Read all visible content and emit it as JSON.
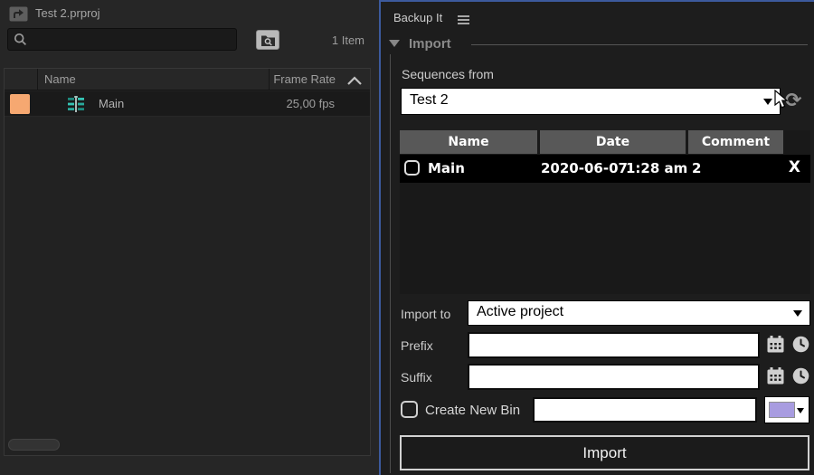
{
  "colors": {
    "accent_border": "#3c5a9d",
    "swatch_orange": "#f6a871",
    "bin_purple": "#a89ce0",
    "sequence_teal": "#2fbca9"
  },
  "left_panel": {
    "title": "Test 2.prproj",
    "search_placeholder": "",
    "item_count": "1 Item",
    "columns": {
      "name": "Name",
      "frame_rate": "Frame Rate"
    },
    "rows": [
      {
        "name": "Main",
        "frame_rate": "25,00 fps"
      }
    ]
  },
  "right_panel": {
    "tab_title": "Backup It",
    "section_title": "Import",
    "sequences_from_label": "Sequences from",
    "sequence_select_value": "Test 2",
    "refresh_glyph": "⟳",
    "table": {
      "headers": [
        "Name",
        "Date",
        "Comment"
      ],
      "row": {
        "name": "Main",
        "date": "2020-06-07",
        "time": "1:28 am",
        "comment": "2",
        "delete": "X"
      }
    },
    "import_to_label": "Import to",
    "import_to_value": "Active project",
    "prefix_label": "Prefix",
    "prefix_value": "",
    "suffix_label": "Suffix",
    "suffix_value": "",
    "create_bin_label": "Create New Bin",
    "bin_name_value": "",
    "import_button_label": "Import"
  }
}
